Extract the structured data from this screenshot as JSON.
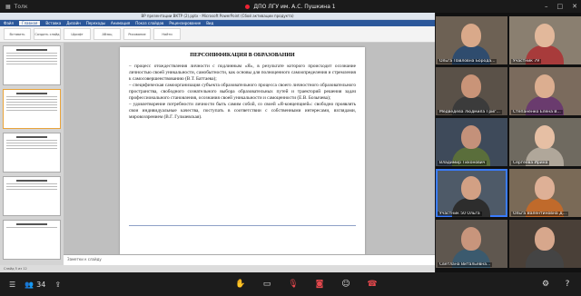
{
  "topbar": {
    "left_label": "Толк",
    "meeting_title": "ДПО ЛГУ им. А.С. Пушкина 1"
  },
  "powerpoint": {
    "window_title": "ВР презентации ВКТР (2).pptx - Microsoft PowerPoint (Сбой активации продукта)",
    "tabs": [
      "Файл",
      "Главная",
      "Вставка",
      "Дизайн",
      "Переходы",
      "Анимация",
      "Показ слайдов",
      "Рецензирование",
      "Вид"
    ],
    "ribbon": [
      "Вставить",
      "Создать слайд",
      "Шрифт",
      "Абзац",
      "Рисование",
      "Найти"
    ],
    "slide": {
      "title": "ПЕРСОНИФИКАЦИЯ В ОБРАЗОВАНИИ",
      "paragraphs": [
        "– процесс отождествления личности с подлинным «Я», в результате которого происходит осознание личностью своей уникальности, самобытности, как основы для полноценного самоопределения и стремления к самосовершенствованию (В.Т. Баттаева);",
        "– специфическая самоорганизация субъекта образовательного процесса своего личностного образовательного пространства, свободного сознательного выбора образовательных путей и траекторий решения задач профессионального становления, осознания своей уникальности и самоценности (Е.В. Бозычева);",
        "– удовлетворение потребности личности быть самим собой, со своей «Я-концепцией»: свободно проявлять свои индивидуальные качества, поступать в соответствии с собственными интересами, взглядами, мировоззрением (В.Г. Гульчевская)."
      ]
    },
    "notes_placeholder": "Заметки к слайду",
    "status": "Слайд 5 из 12"
  },
  "participants": [
    {
      "name": "Ольга Павловна Борода...",
      "active": false
    },
    {
      "name": "Участник 79",
      "active": false
    },
    {
      "name": "Медведева Людмила Григ...",
      "active": false
    },
    {
      "name": "Степаненко Елена В...",
      "active": false
    },
    {
      "name": "Владимир Тихонович",
      "active": false
    },
    {
      "name": "Сергеева Ирина",
      "active": false
    },
    {
      "name": "Участник 50 Ольга",
      "active": true
    },
    {
      "name": "Ольга Валентиновна Д...",
      "active": false
    },
    {
      "name": "Светлана Витальевна...",
      "active": false
    },
    {
      "name": "",
      "active": false
    }
  ],
  "bottombar": {
    "participants_count": "34"
  },
  "colors": {
    "accent_blue": "#3a7cff",
    "record_red": "#e23",
    "powerpoint_blue": "#2b579a"
  }
}
